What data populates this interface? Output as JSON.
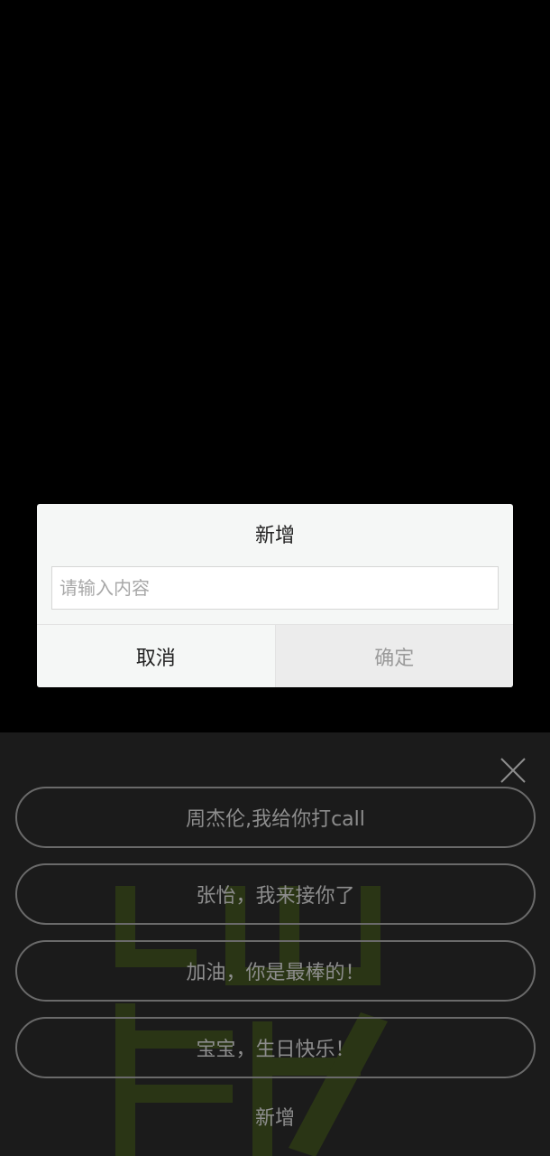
{
  "dialog": {
    "title": "新增",
    "input_placeholder": "请输入内容",
    "input_value": "",
    "cancel_label": "取消",
    "confirm_label": "确定"
  },
  "panel": {
    "close_icon": "close-icon",
    "items": [
      {
        "label": "周杰伦,我给你打call"
      },
      {
        "label": "张怡，我来接你了"
      },
      {
        "label": "加油，你是最棒的！"
      },
      {
        "label": "宝宝，生日快乐！"
      }
    ],
    "add_label": "新增"
  },
  "colors": {
    "background": "#000000",
    "panel_bg": "#1b1b1b",
    "dialog_bg": "#f5f7f6",
    "watermark": "#2a3515",
    "pill_border": "#6a6a6a",
    "pill_text": "#8d8d8d"
  }
}
